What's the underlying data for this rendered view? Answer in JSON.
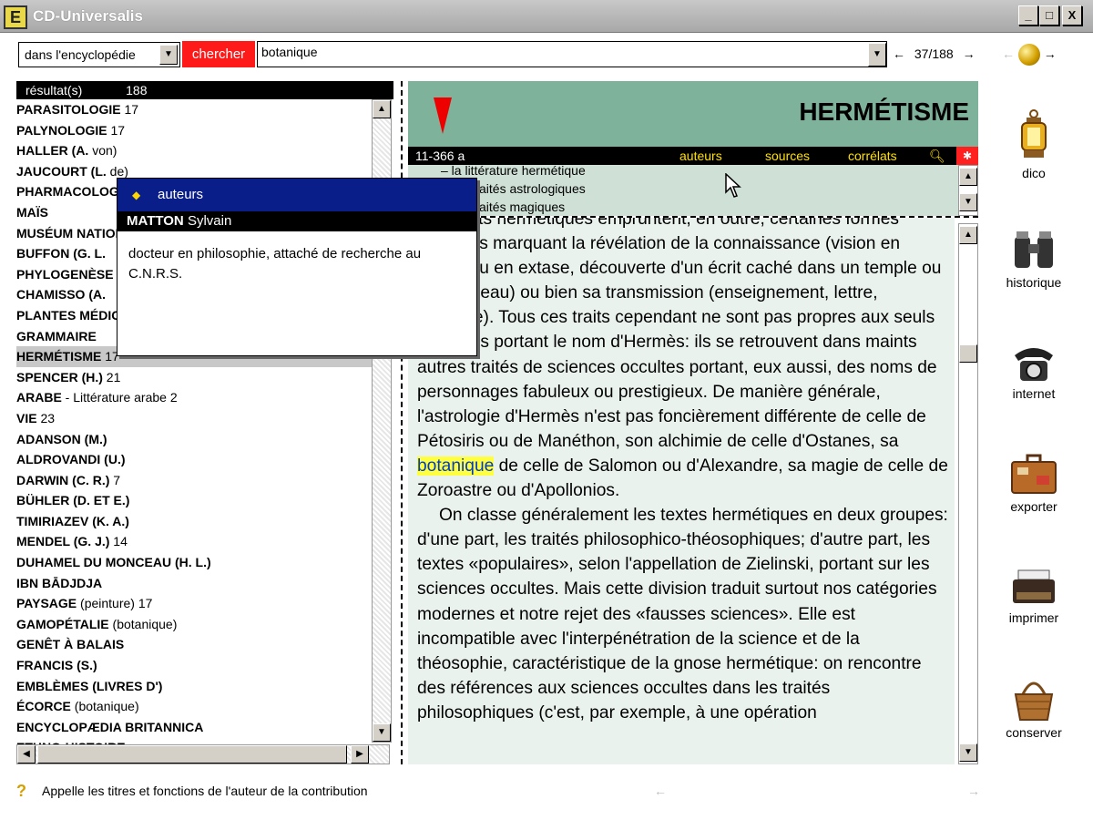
{
  "window": {
    "title": "CD-Universalis",
    "app_icon": "E",
    "min": "_",
    "max": "□",
    "close": "X"
  },
  "search": {
    "scope": "dans l'encyclopédie",
    "button": "chercher",
    "query": "botanique",
    "counter": "37/188",
    "prev": "←",
    "next": "→"
  },
  "results": {
    "header_label": "résultat(s)",
    "header_count": "188",
    "items": [
      {
        "bold": "PARASITOLOGIE",
        "rest": " 17"
      },
      {
        "bold": "PALYNOLOGIE",
        "rest": " 17"
      },
      {
        "bold": "HALLER (A.",
        "rest": " von)"
      },
      {
        "bold": "JAUCOURT (L.",
        "rest": " de)"
      },
      {
        "bold": "PHARMACOLOGIE",
        "rest": ""
      },
      {
        "bold": "MAÏS",
        "rest": ""
      },
      {
        "bold": "MUSÉUM NATIONAL",
        "rest": ""
      },
      {
        "bold": "BUFFON (G. L.",
        "rest": ""
      },
      {
        "bold": "PHYLOGENÈSE",
        "rest": ""
      },
      {
        "bold": "CHAMISSO (A.",
        "rest": ""
      },
      {
        "bold": "PLANTES MÉDICINALES",
        "rest": ""
      },
      {
        "bold": "GRAMMAIRE",
        "rest": ""
      },
      {
        "bold": "HERMÉTISME",
        "rest": " 17"
      },
      {
        "bold": "SPENCER (H.)",
        "rest": " 21"
      },
      {
        "bold": "ARABE",
        "rest": " - Littérature arabe 2"
      },
      {
        "bold": "VIE",
        "rest": " 23"
      },
      {
        "bold": "ADANSON (M.)",
        "rest": ""
      },
      {
        "bold": "ALDROVANDI (U.)",
        "rest": ""
      },
      {
        "bold": "DARWIN (C. R.)",
        "rest": " 7"
      },
      {
        "bold": "BÜHLER (D. ET E.)",
        "rest": ""
      },
      {
        "bold": "TIMIRIAZEV (K. A.)",
        "rest": ""
      },
      {
        "bold": "MENDEL (G. J.)",
        "rest": " 14"
      },
      {
        "bold": "DUHAMEL DU MONCEAU (H. L.)",
        "rest": ""
      },
      {
        "bold": "IBN BĀDJDJA",
        "rest": ""
      },
      {
        "bold": "PAYSAGE",
        "rest": " (peinture) 17"
      },
      {
        "bold": "GAMOPÉTALIE",
        "rest": " (botanique)"
      },
      {
        "bold": "GENÊT À BALAIS",
        "rest": ""
      },
      {
        "bold": "FRANCIS (S.)",
        "rest": ""
      },
      {
        "bold": "EMBLÈMES (LIVRES D')",
        "rest": ""
      },
      {
        "bold": "ÉCORCE",
        "rest": " (botanique)"
      },
      {
        "bold": "ENCYCLOPÆDIA BRITANNICA",
        "rest": ""
      },
      {
        "bold": "ETHNO-HISTOIRE",
        "rest": ""
      }
    ],
    "selected_index": 12
  },
  "article": {
    "title": "HERMÉTISME",
    "code": "11-366 a",
    "links": [
      "auteurs",
      "sources",
      "corrélats"
    ],
    "toc": [
      "– la littérature hermétique",
      "– les traités astrologiques",
      "– les traités magiques"
    ],
    "para1_before": "Les écrits hermétiques empruntent, en outre, certaines formes littéraires marquant la révélation de la connaissance (vision en songe ou en extase, découverte d'un écrit caché dans un temple ou un tombeau) ou bien sa transmission (enseignement, lettre, dialogue). Tous ces traits cependant ne sont pas propres aux seuls ouvrages portant le nom d'Hermès: ils se retrouvent dans maints autres traités de sciences occultes portant, eux aussi, des noms de personnages fabuleux ou prestigieux. De manière générale, l'astrologie d'Hermès n'est pas foncièrement différente de celle de Pétosiris ou de Manéthon, son alchimie de celle d'Ostanes, sa ",
    "para1_highlight": "botanique",
    "para1_after": " de celle de Salomon ou d'Alexandre, sa magie de celle de Zoroastre ou d'Apollonios.",
    "para2": "On classe généralement les textes hermétiques en deux groupes: d'une part, les traités philosophico-théosophiques; d'autre part, les textes «populaires», selon l'appellation de Zielinski, portant sur les sciences occultes. Mais cette division traduit surtout nos catégories modernes et notre rejet des «fausses sciences». Elle est incompatible avec l'interpénétration de la science et de la théosophie, caractéristique de la gnose hermétique: on rencontre des références aux sciences occultes dans les traités philosophiques (c'est, par exemple, à une opération"
  },
  "popup": {
    "header": "auteurs",
    "author_last": "MATTON",
    "author_first": " Sylvain",
    "description": "docteur en philosophie, attaché de recherche au C.N.R.S."
  },
  "tools": [
    {
      "icon": "lantern-icon",
      "label": "dico"
    },
    {
      "icon": "binoculars-icon",
      "label": "historique"
    },
    {
      "icon": "telephone-icon",
      "label": "internet"
    },
    {
      "icon": "suitcase-icon",
      "label": "exporter"
    },
    {
      "icon": "typewriter-icon",
      "label": "imprimer"
    },
    {
      "icon": "basket-icon",
      "label": "conserver"
    }
  ],
  "status": {
    "icon": "help-icon",
    "text": "Appelle les titres et fonctions de l'auteur de la contribution",
    "prev": "←",
    "next": "→"
  }
}
